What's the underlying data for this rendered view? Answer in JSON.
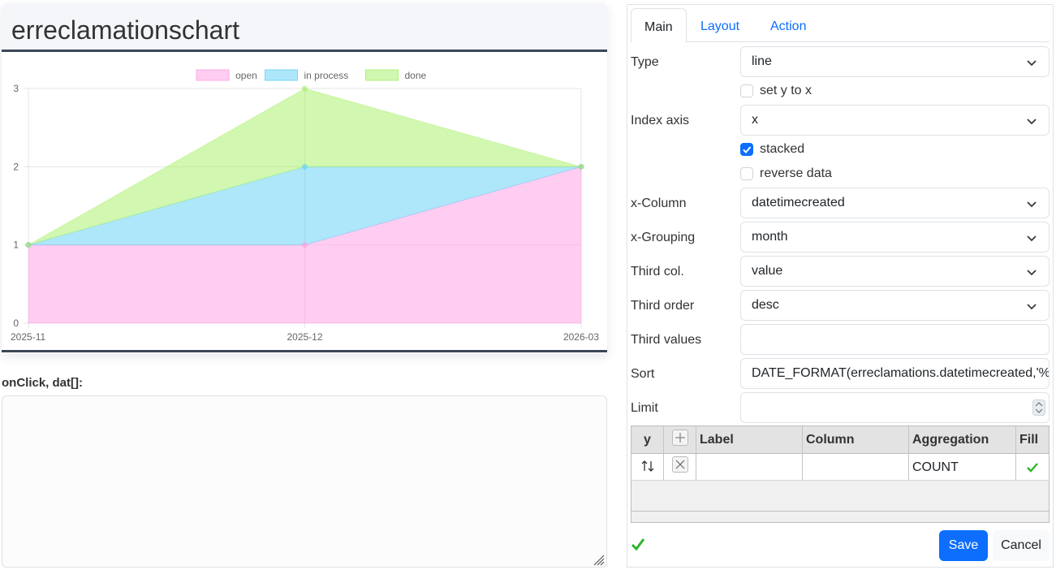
{
  "chart_card": {
    "title": "erreclamationschart"
  },
  "chart_data": {
    "type": "area",
    "stacked": true,
    "categories": [
      "2025-11",
      "2025-12",
      "2026-03"
    ],
    "series": [
      {
        "name": "open",
        "values": [
          1,
          1,
          2
        ],
        "color": "#ff9be4"
      },
      {
        "name": "in process",
        "values": [
          0,
          1,
          0
        ],
        "color": "#5dd0f5"
      },
      {
        "name": "done",
        "values": [
          0,
          1,
          0
        ],
        "color": "#a3f062"
      }
    ],
    "ylim": [
      0,
      3
    ],
    "yticks": [
      "0",
      "1",
      "2",
      "3"
    ],
    "legend_position": "top",
    "grid": true
  },
  "onclick": {
    "label": "onClick, dat[]:",
    "value": ""
  },
  "tabs": [
    {
      "label": "Main",
      "active": true
    },
    {
      "label": "Layout",
      "active": false
    },
    {
      "label": "Action",
      "active": false
    }
  ],
  "form": {
    "type_label": "Type",
    "type_value": "line",
    "set_y_to_x_label": "set y to x",
    "set_y_to_x_checked": false,
    "index_axis_label": "Index axis",
    "index_axis_value": "x",
    "stacked_label": "stacked",
    "stacked_checked": true,
    "reverse_data_label": "reverse data",
    "reverse_data_checked": false,
    "x_column_label": "x-Column",
    "x_column_value": "datetimecreated",
    "x_grouping_label": "x-Grouping",
    "x_grouping_value": "month",
    "third_col_label": "Third col.",
    "third_col_value": "value",
    "third_order_label": "Third order",
    "third_order_value": "desc",
    "third_values_label": "Third values",
    "third_values_value": "",
    "sort_label": "Sort",
    "sort_value": "DATE_FORMAT(erreclamations.datetimecreated,'%Y",
    "limit_label": "Limit",
    "limit_value": ""
  },
  "series_table": {
    "headers": {
      "y": "y",
      "label": "Label",
      "column": "Column",
      "aggregation": "Aggregation",
      "fill": "Fill"
    },
    "rows": [
      {
        "label": "",
        "column": "",
        "aggregation": "COUNT",
        "fill": true
      }
    ]
  },
  "footer": {
    "save_label": "Save",
    "cancel_label": "Cancel"
  },
  "colors": {
    "accent": "#0d6efd",
    "ok_green": "#2db52d",
    "header_border": "#3c4656"
  }
}
